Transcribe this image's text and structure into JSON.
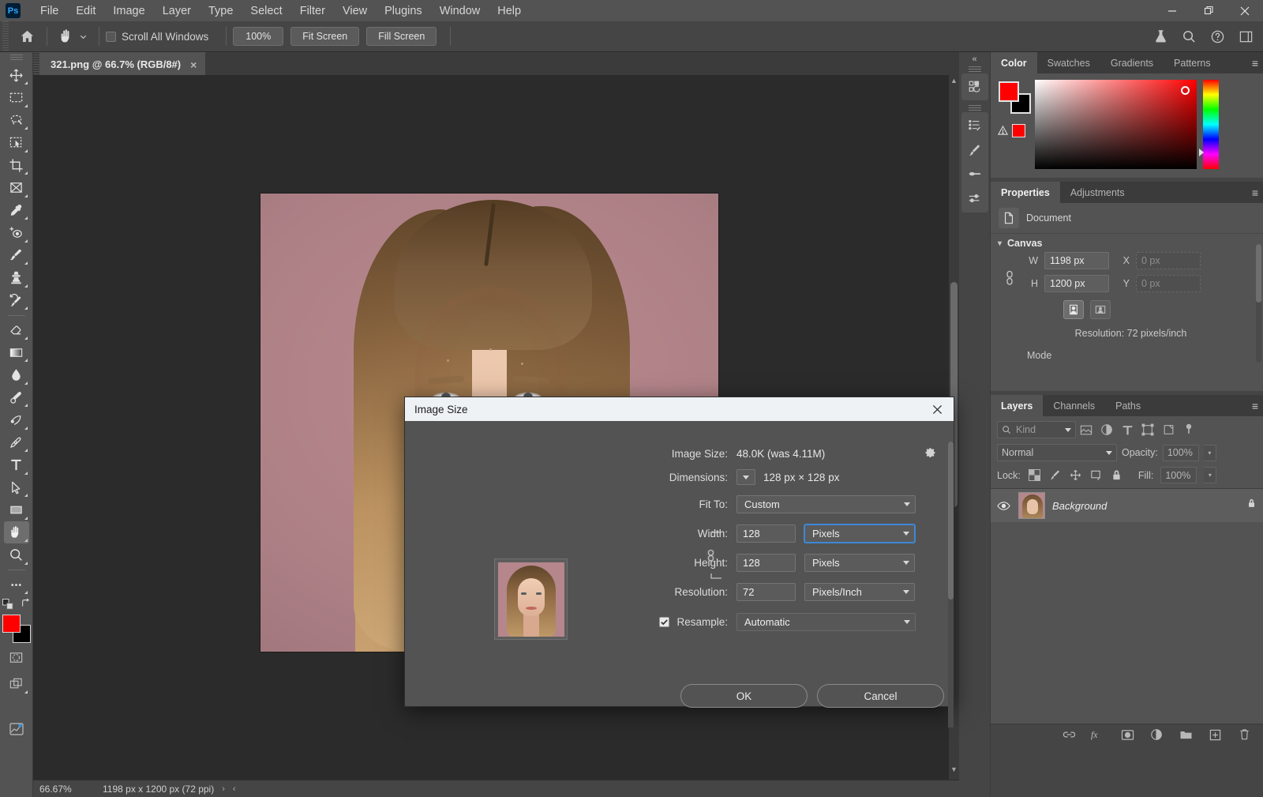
{
  "app": {
    "logo": "Ps",
    "menus": [
      "File",
      "Edit",
      "Image",
      "Layer",
      "Type",
      "Select",
      "Filter",
      "View",
      "Plugins",
      "Window",
      "Help"
    ],
    "window_controls": [
      "minimize-button",
      "restore-button",
      "close-button"
    ]
  },
  "options_bar": {
    "home_icon": "home-icon",
    "active_tool_icon": "hand-tool-icon",
    "scroll_all_windows_label": "Scroll All Windows",
    "scroll_all_windows_checked": false,
    "buttons": [
      "100%",
      "Fit Screen",
      "Fill Screen"
    ],
    "right_icons": [
      "labs-flask-icon",
      "search-icon",
      "help-icon",
      "workspace-icon"
    ]
  },
  "toolbar": {
    "tools": [
      {
        "name": "move-tool",
        "icon": "move-icon"
      },
      {
        "name": "rectangular-marquee-tool",
        "icon": "marquee-icon"
      },
      {
        "name": "lasso-tool",
        "icon": "lasso-icon"
      },
      {
        "name": "object-selection-tool",
        "icon": "object-select-icon"
      },
      {
        "name": "crop-tool",
        "icon": "crop-icon"
      },
      {
        "name": "frame-tool",
        "icon": "frame-icon"
      },
      {
        "name": "eyedropper-tool",
        "icon": "eyedropper-icon"
      },
      {
        "name": "spot-healing-brush-tool",
        "icon": "healing-icon"
      },
      {
        "name": "brush-tool",
        "icon": "brush-icon"
      },
      {
        "name": "clone-stamp-tool",
        "icon": "stamp-icon"
      },
      {
        "name": "history-brush-tool",
        "icon": "history-brush-icon"
      },
      {
        "name": "eraser-tool",
        "icon": "eraser-icon"
      },
      {
        "name": "gradient-tool",
        "icon": "gradient-icon"
      },
      {
        "name": "blur-tool",
        "icon": "blur-drop-icon"
      },
      {
        "name": "dodge-tool",
        "icon": "dodge-icon"
      },
      {
        "name": "pen-tool",
        "icon": "pen-icon"
      },
      {
        "name": "freeform-pen-tool",
        "icon": "freeform-pen-icon"
      },
      {
        "name": "type-tool",
        "icon": "type-T-icon"
      },
      {
        "name": "path-selection-tool",
        "icon": "path-arrow-icon"
      },
      {
        "name": "rectangle-tool",
        "icon": "rectangle-icon"
      },
      {
        "name": "hand-tool",
        "icon": "hand-icon",
        "active": true
      },
      {
        "name": "zoom-tool",
        "icon": "magnifier-icon"
      },
      {
        "name": "edit-toolbar",
        "icon": "ellipsis-icon"
      }
    ],
    "foreground_color": "#fe0000",
    "background_color": "#000000",
    "quick_mask_icon": "quick-mask-icon",
    "screen_mode_icon": "screen-mode-icon"
  },
  "document": {
    "tab_title": "321.png @ 66.7% (RGB/8#)",
    "close_glyph": "×"
  },
  "status_bar": {
    "zoom": "66.67%",
    "doc_info": "1198 px x 1200 px (72 ppi)",
    "arrow_glyph": "›",
    "left_arrow_glyph": "‹"
  },
  "rail": {
    "collapse_glyph": "«",
    "icons": [
      "history-icon",
      "actions-icon",
      "brush-settings-icon",
      "brushes-icon",
      "adjustments-slider-icon"
    ]
  },
  "color_panel": {
    "tabs": [
      "Color",
      "Swatches",
      "Gradients",
      "Patterns"
    ],
    "active_tab": "Color",
    "foreground": "#fe0000",
    "background": "#000000",
    "out_of_gamut_icon": "gamut-warning-icon",
    "menu_glyph": "≡"
  },
  "properties_panel": {
    "tabs": [
      "Properties",
      "Adjustments"
    ],
    "active_tab": "Properties",
    "doc_icon": "document-icon",
    "doc_label": "Document",
    "section": "Canvas",
    "width_label": "W",
    "width_value": "1198 px",
    "height_label": "H",
    "height_value": "1200 px",
    "x_label": "X",
    "x_placeholder": "0 px",
    "y_label": "Y",
    "y_placeholder": "0 px",
    "orientation_portrait_icon": "portrait-orientation-icon",
    "orientation_landscape_icon": "landscape-orientation-icon",
    "resolution_line": "Resolution: 72 pixels/inch",
    "mode_label": "Mode",
    "link_icon": "link-constrain-icon"
  },
  "layers_panel": {
    "tabs": [
      "Layers",
      "Channels",
      "Paths"
    ],
    "active_tab": "Layers",
    "filter_placeholder": "Kind",
    "filter_icons": [
      "filter-pixel-icon",
      "filter-adjustment-icon",
      "filter-type-icon",
      "filter-shape-icon",
      "filter-smart-icon"
    ],
    "filter_toggle_icon": "filter-toggle-icon",
    "blend_mode": "Normal",
    "opacity_label": "Opacity:",
    "opacity_value": "100%",
    "lock_label": "Lock:",
    "lock_icons": [
      "lock-transparent-icon",
      "lock-image-icon",
      "lock-position-icon",
      "lock-artboard-icon",
      "lock-all-icon"
    ],
    "fill_label": "Fill:",
    "fill_value": "100%",
    "layers": [
      {
        "name": "Background",
        "visible": true,
        "locked": true,
        "thumb": "portrait-thumbnail"
      }
    ],
    "footer_icons": [
      "link-layers-icon",
      "fx-icon",
      "add-mask-icon",
      "adjustment-layer-icon",
      "new-group-icon",
      "new-layer-icon",
      "delete-layer-icon"
    ]
  },
  "dialog": {
    "title": "Image Size",
    "close_glyph": "×",
    "image_size_label": "Image Size:",
    "image_size_value": "48.0K (was 4.11M)",
    "gear_icon": "gear-icon",
    "dimensions_label": "Dimensions:",
    "dimensions_value": "128 px  ×  128 px",
    "fit_to_label": "Fit To:",
    "fit_to_value": "Custom",
    "width_label": "Width:",
    "width_value": "128",
    "width_unit": "Pixels",
    "height_label": "Height:",
    "height_value": "128",
    "height_unit": "Pixels",
    "resolution_label": "Resolution:",
    "resolution_value": "72",
    "resolution_unit": "Pixels/Inch",
    "resample_label": "Resample:",
    "resample_value": "Automatic",
    "resample_checked": true,
    "constrain_icon": "constrain-proportions-icon",
    "preview_icon": "image-preview-thumbnail",
    "ok_label": "OK",
    "cancel_label": "Cancel"
  },
  "canvas": {
    "artwork": "portrait-photo",
    "background_color": "#b5878c"
  }
}
